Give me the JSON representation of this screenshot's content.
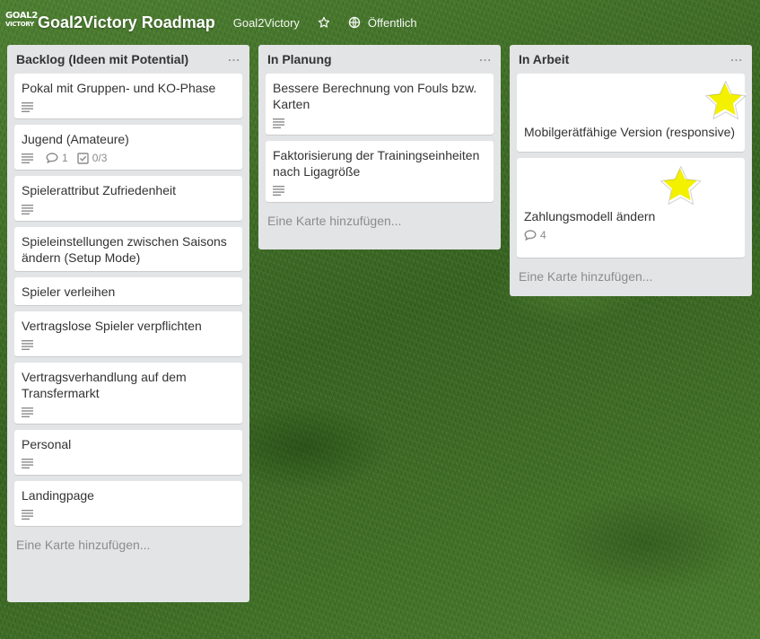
{
  "header": {
    "logo_line1": "GOAL2",
    "logo_line2": "VICTORY",
    "board_title": "Goal2Victory Roadmap",
    "team_name": "Goal2Victory",
    "visibility_label": "Öffentlich"
  },
  "lists": [
    {
      "title": "Backlog (Ideen mit Potential)",
      "menu": "...",
      "add_card": "Eine Karte hinzufügen...",
      "cards": [
        {
          "title": "Pokal mit Gruppen- und KO-Phase"
        },
        {
          "title": "Jugend (Amateure)",
          "comments": "1",
          "checklist": "0/3"
        },
        {
          "title": "Spielerattribut Zufriedenheit"
        },
        {
          "title": "Spieleinstellungen zwischen Saisons ändern (Setup Mode)"
        },
        {
          "title": "Spieler verleihen"
        },
        {
          "title": "Vertragslose Spieler verpflichten"
        },
        {
          "title": "Vertragsverhandlung auf dem Transfermarkt"
        },
        {
          "title": "Personal"
        },
        {
          "title": "Landingpage"
        }
      ]
    },
    {
      "title": "In Planung",
      "menu": "...",
      "add_card": "Eine Karte hinzufügen...",
      "cards": [
        {
          "title": "Bessere Berechnung von Fouls bzw. Karten"
        },
        {
          "title": "Faktorisierung der Trainingseinheiten nach Ligagröße"
        }
      ]
    },
    {
      "title": "In Arbeit",
      "menu": "...",
      "add_card": "Eine Karte hinzufügen...",
      "cards": [
        {
          "title": "Mobilgerätfähige Version (responsive)",
          "sticker": "star-sticker"
        },
        {
          "title": "Zahlungsmodell ändern",
          "comments": "4",
          "sticker": "star-sticker"
        }
      ]
    }
  ],
  "colors": {
    "list_bg": "#e2e4e6",
    "card_bg": "#ffffff",
    "muted_text": "#8c8c8c",
    "star_yellow": "#f3f000"
  }
}
